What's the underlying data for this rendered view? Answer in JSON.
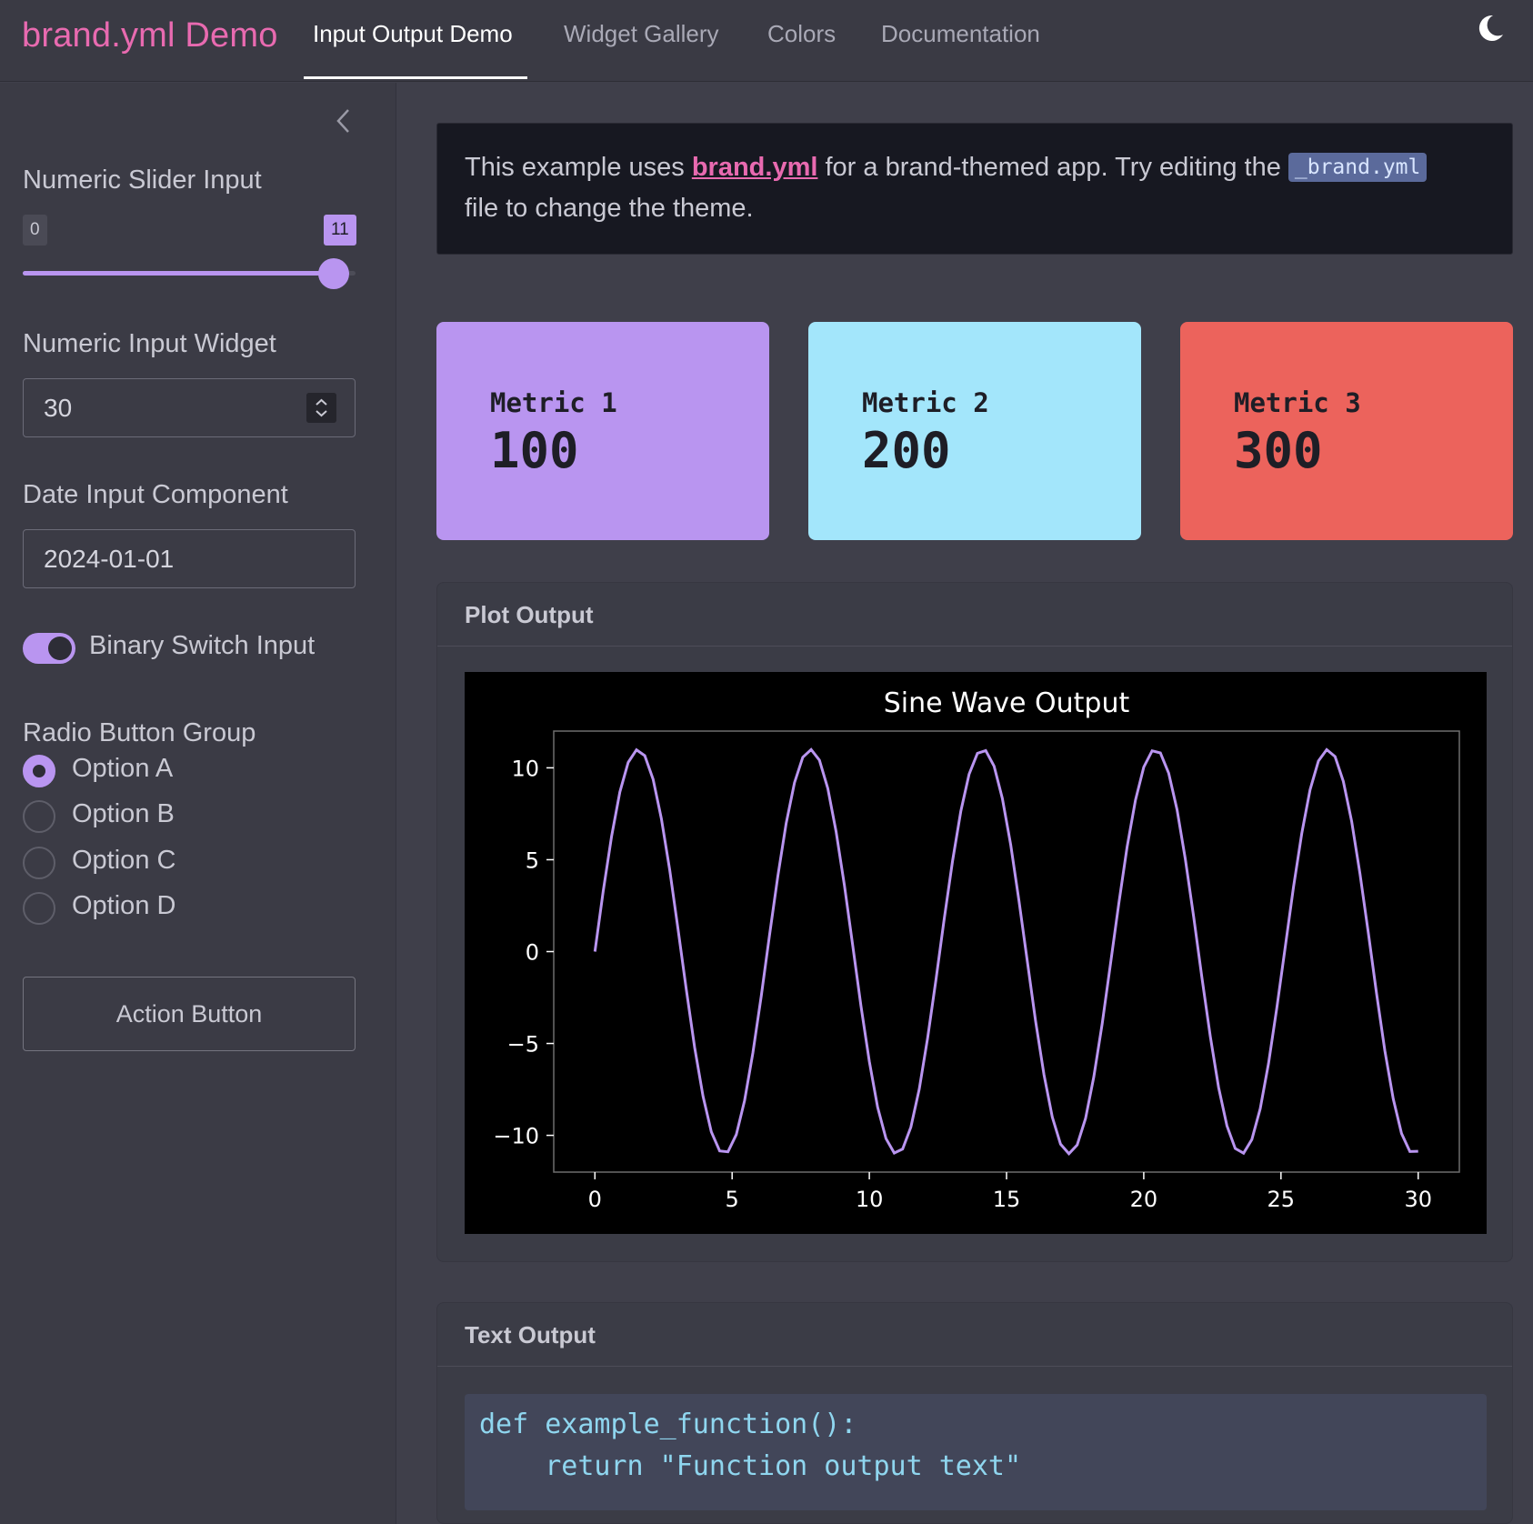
{
  "navbar": {
    "brand": "brand.yml Demo",
    "tabs": [
      {
        "label": "Input Output Demo",
        "active": true
      },
      {
        "label": "Widget Gallery",
        "active": false
      },
      {
        "label": "Colors",
        "active": false
      },
      {
        "label": "Documentation",
        "active": false
      }
    ],
    "theme_icon": "moon-icon"
  },
  "sidebar": {
    "slider": {
      "label": "Numeric Slider Input",
      "min": "0",
      "value": "11",
      "fraction": 0.98
    },
    "numeric": {
      "label": "Numeric Input Widget",
      "value": "30"
    },
    "date": {
      "label": "Date Input Component",
      "value": "2024-01-01"
    },
    "switch": {
      "label": "Binary Switch Input",
      "on": true
    },
    "radio": {
      "label": "Radio Button Group",
      "options": [
        "Option A",
        "Option B",
        "Option C",
        "Option D"
      ],
      "selected": "Option A"
    },
    "action_button": "Action Button"
  },
  "callout": {
    "text1": "This example uses ",
    "link": "brand.yml",
    "text2": " for a brand-themed app. Try editing the ",
    "code": "_brand.yml",
    "text3": "file to change the theme."
  },
  "metrics": [
    {
      "title": "Metric 1",
      "value": "100",
      "color": "#b995f0"
    },
    {
      "title": "Metric 2",
      "value": "200",
      "color": "#a3e6fb"
    },
    {
      "title": "Metric 3",
      "value": "300",
      "color": "#ec635c"
    }
  ],
  "plot_card": {
    "title": "Plot Output"
  },
  "text_card": {
    "title": "Text Output",
    "code_lines": [
      "def example_function():",
      "    return \"Function output text\""
    ]
  },
  "colors": {
    "accent": "#b995f0",
    "brand_pink": "#e86ab0"
  },
  "chart_data": {
    "type": "line",
    "title": "Sine Wave Output",
    "xlabel": "",
    "ylabel": "",
    "function": "11*sin(x)",
    "x_range": [
      0,
      30
    ],
    "xlim": [
      -1.5,
      31.5
    ],
    "ylim": [
      -12,
      12
    ],
    "xticks": [
      0,
      5,
      10,
      15,
      20,
      25,
      30
    ],
    "yticks": [
      10,
      5,
      0,
      -5,
      -10
    ],
    "xtick_labels": [
      "0",
      "5",
      "10",
      "15",
      "20",
      "25",
      "30"
    ],
    "ytick_labels": [
      "10",
      "5",
      "0",
      "−5",
      "−10"
    ],
    "amplitude": 11,
    "n_points": 100,
    "line_color": "#b995f0",
    "grid": false
  }
}
